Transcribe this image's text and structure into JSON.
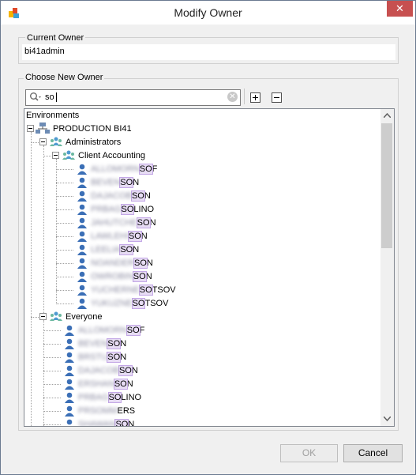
{
  "window": {
    "title": "Modify Owner",
    "close_glyph": "✕"
  },
  "current_owner": {
    "legend": "Current Owner",
    "value": "bi41admin"
  },
  "choose_owner": {
    "legend": "Choose New Owner",
    "search_value": "so",
    "toolbar": {
      "expand_all_icon": "plus-box-icon",
      "collapse_all_icon": "minus-box-icon"
    }
  },
  "tree": {
    "header": "Environments",
    "root": "PRODUCTION BI41",
    "groups": [
      {
        "label": "Administrators"
      },
      {
        "label": "Client Accounting"
      },
      {
        "label": "Everyone"
      }
    ],
    "client_accounting_users": [
      {
        "pre": "ALLOMORN",
        "hl": "SO",
        "post": "F"
      },
      {
        "pre": "BEVEN",
        "hl": "SO",
        "post": "N"
      },
      {
        "pre": "DAJACOB",
        "hl": "SO",
        "post": "N"
      },
      {
        "pre": "PRBAG",
        "hl": "SO",
        "post": "LINO"
      },
      {
        "pre": "JAHUTCHE",
        "hl": "SO",
        "post": "N"
      },
      {
        "pre": "LAWLEHI",
        "hl": "SO",
        "post": "N"
      },
      {
        "pre": "LEELIA",
        "hl": "SO",
        "post": "N"
      },
      {
        "pre": "NOANDER",
        "hl": "SO",
        "post": "N"
      },
      {
        "pre": "OWROBIN",
        "hl": "SO",
        "post": "N"
      },
      {
        "pre": "YUCHERNE",
        "hl": "SO",
        "post": "TSOV"
      },
      {
        "pre": "YUKUZNE",
        "hl": "SO",
        "post": "TSOV"
      }
    ],
    "everyone_users": [
      {
        "pre": "ALLOMORN",
        "hl": "SO",
        "post": "F"
      },
      {
        "pre": "BEVEN",
        "hl": "SO",
        "post": "N"
      },
      {
        "pre": "BRSTU",
        "hl": "SO",
        "post": "N"
      },
      {
        "pre": "DAJACOB",
        "hl": "SO",
        "post": "N"
      },
      {
        "pre": "ERSHAN",
        "hl": "SO",
        "post": "N"
      },
      {
        "pre": "PRBAG",
        "hl": "SO",
        "post": "LINO"
      },
      {
        "pre": "PRSOMM",
        "hl": "",
        "post": "ERS"
      },
      {
        "pre": "SHAWAN",
        "hl": "SO",
        "post": "N"
      }
    ]
  },
  "buttons": {
    "ok": "OK",
    "cancel": "Cancel"
  },
  "colors": {
    "user_icon": "#3b6fb6",
    "group_icon": "#4f9bd0",
    "highlight": "#e7dcf4",
    "close": "#c75050"
  }
}
